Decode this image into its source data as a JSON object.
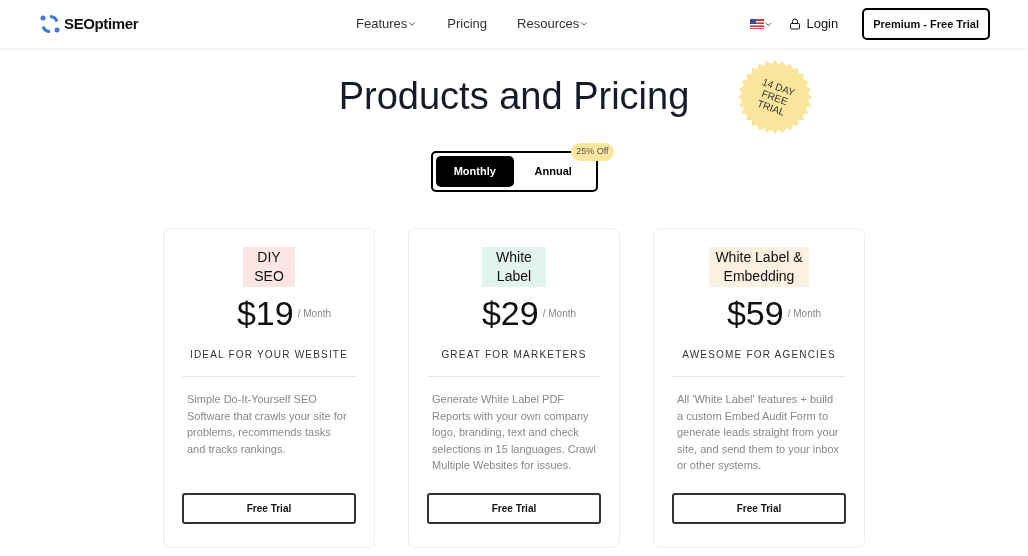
{
  "header": {
    "brand": "SEOptimer",
    "nav": [
      {
        "label": "Features",
        "dropdown": true
      },
      {
        "label": "Pricing",
        "dropdown": false
      },
      {
        "label": "Resources",
        "dropdown": true
      }
    ],
    "login": "Login",
    "cta": "Premium - Free Trial"
  },
  "title": "Products and Pricing",
  "sticker": "14 DAY FREE TRIAL",
  "billing": {
    "options": [
      {
        "label": "Monthly",
        "selected": true
      },
      {
        "label": "Annual",
        "selected": false
      }
    ],
    "badge": "25% Off"
  },
  "plans": [
    {
      "name": "DIY SEO",
      "color": "#fbe6e4",
      "price": "$19",
      "period": "/ Month",
      "tagline": "IDEAL FOR YOUR WEBSITE",
      "description": "Simple Do-It-Yourself SEO Software that crawls your site for problems, recommends tasks and tracks rankings.",
      "button": "Free Trial"
    },
    {
      "name": "White Label",
      "color": "#e1f5ec",
      "price": "$29",
      "period": "/ Month",
      "tagline": "GREAT FOR MARKETERS",
      "description": "Generate White Label PDF Reports with your own company logo, branding, text and check selections in 15 languages. Crawl Multiple Websites for issues.",
      "button": "Free Trial"
    },
    {
      "name": "White Label & Embedding",
      "color": "#fcf0e0",
      "price": "$59",
      "period": "/ Month",
      "tagline": "AWESOME FOR AGENCIES",
      "description": "All 'White Label' features + build a custom Embed Audit Form to generate leads straight from your site, and send them to your inbox or other systems.",
      "button": "Free Trial"
    }
  ]
}
